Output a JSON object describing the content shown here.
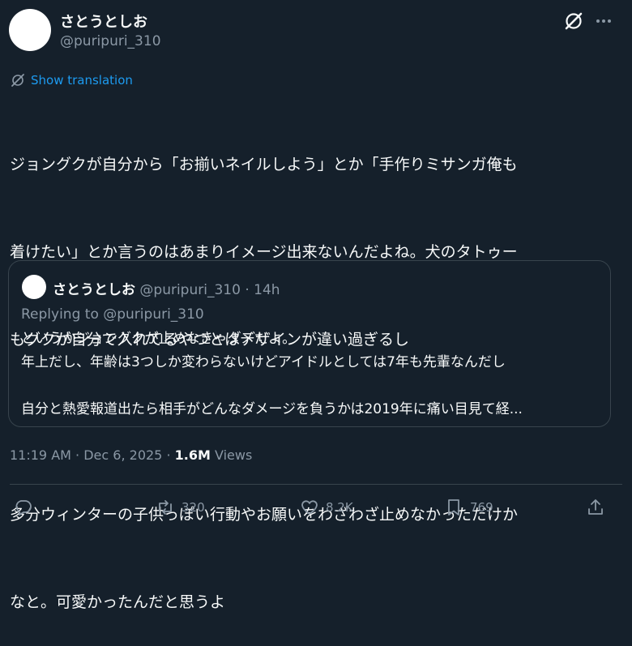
{
  "author": {
    "name": "さとうとしお",
    "handle": "@puripuri_310"
  },
  "translate": {
    "label": "Show translation"
  },
  "tweet": {
    "lines": [
      "ジョングクが自分から「お揃いネイルしよう」とか「手作りミサンガ俺も",
      "着けたい」とか言うのはあまりイメージ出来ないんだよね。犬のタトゥー",
      "もグクが自分で入れてるやつとはデザインが違い過ぎるし",
      "",
      "多分ウィンターの子供っぽい行動やお願いをわざわざ止めなかっただけか",
      "なと。可愛かったんだと思うよ"
    ]
  },
  "quote": {
    "name": "さとうとしお",
    "handle": "@puripuri_310",
    "separator": "·",
    "time": "14h",
    "replying_to": "Replying to @puripuri_310",
    "lines": [
      "というかジョングクが止めなきゃダメだよ。",
      "年上だし、年齢は3つしか変わらないけどアイドルとしては7年も先輩なんだし",
      "",
      "自分と熱愛報道出たら相手がどんなダメージを負うかは2019年に痛い目見て経..."
    ]
  },
  "meta": {
    "time": "11:19 AM",
    "date": "Dec 6, 2025",
    "separator": "·",
    "views_count": "1.6M",
    "views_label": "Views"
  },
  "actions": {
    "replies": "",
    "reposts": "320",
    "likes": "8.2K",
    "bookmarks": "769"
  },
  "icons": [
    "grok-icon",
    "more-icon",
    "translate-icon",
    "reply-icon",
    "repost-icon",
    "like-icon",
    "bookmark-icon",
    "share-icon"
  ],
  "colors": {
    "background": "#15202b",
    "text": "#f7f9f9",
    "secondary": "#8b98a5",
    "accent": "#1d9bf0",
    "border": "#38444d"
  }
}
